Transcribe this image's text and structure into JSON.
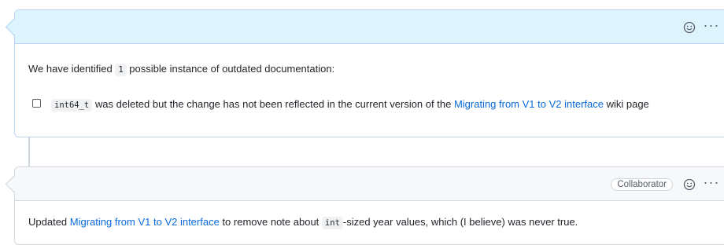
{
  "comment1": {
    "intro_pre": "We have identified",
    "count": "1",
    "intro_post": "possible instance of outdated documentation:",
    "task": {
      "code": "int64_t",
      "text_pre": "was deleted but the change has not been reflected in the current version of the",
      "link": "Migrating from V1 to V2 interface",
      "text_post": "wiki page",
      "checked": false
    },
    "icons": [
      "smiley-icon",
      "kebab-icon"
    ]
  },
  "comment2": {
    "badge": "Collaborator",
    "text_pre": "Updated",
    "link": "Migrating from V1 to V2 interface",
    "text_mid": "to remove note about",
    "code": "int",
    "text_post": "-sized year values, which (I believe) was never true.",
    "icons": [
      "smiley-icon",
      "kebab-icon"
    ]
  },
  "colors": {
    "link": "#0969da",
    "header_highlight": "#ddf4ff",
    "header_default": "#f6f8fa"
  }
}
